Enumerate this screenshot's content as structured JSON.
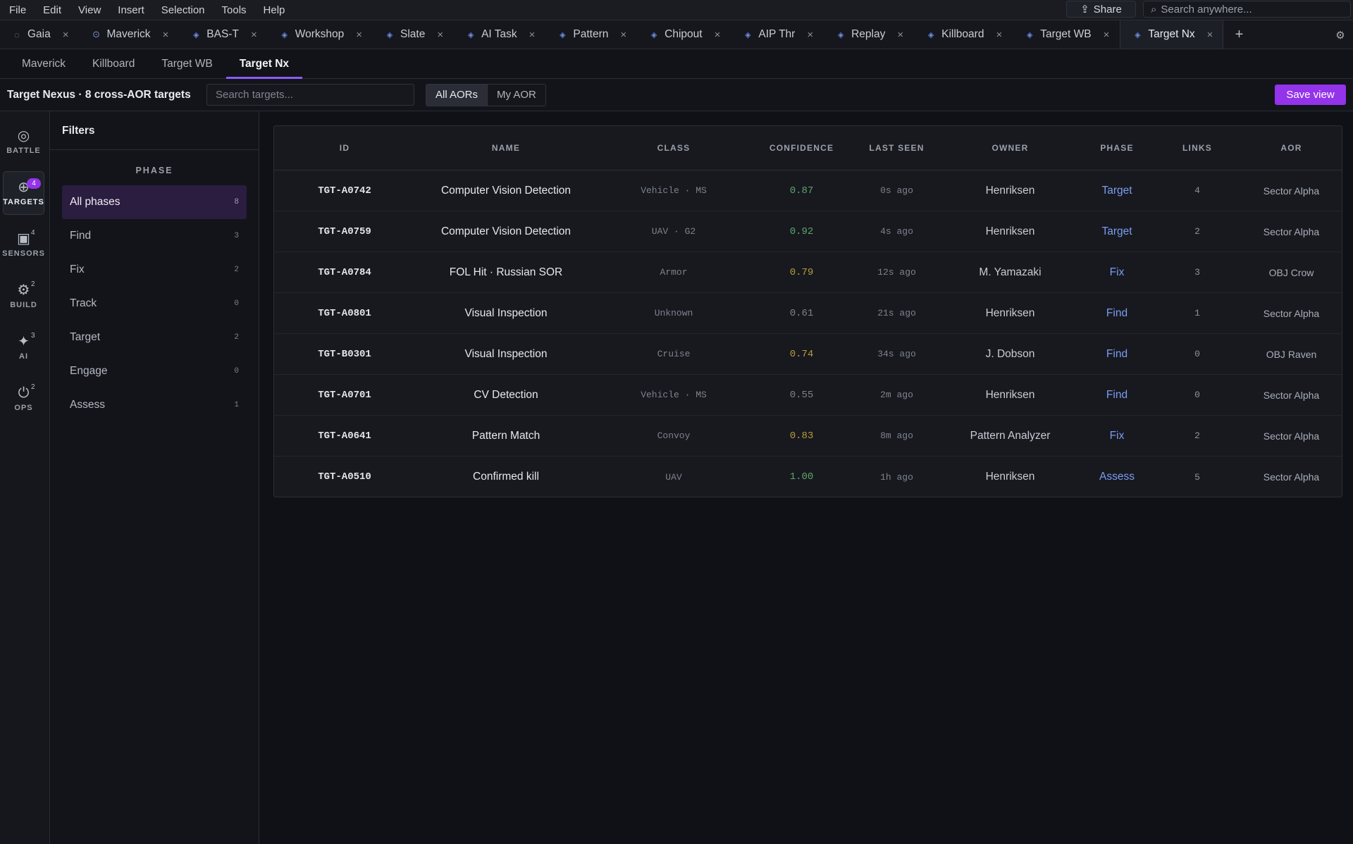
{
  "menu": [
    "File",
    "Edit",
    "View",
    "Insert",
    "Selection",
    "Tools",
    "Help"
  ],
  "share": {
    "label": "Share",
    "icon": "share-icon"
  },
  "global_search": {
    "placeholder": "Search anywhere..."
  },
  "doc_tabs": [
    {
      "label": "Gaia",
      "icon": "circle-icon"
    },
    {
      "label": "Maverick",
      "icon": "target-icon"
    },
    {
      "label": "BAS-T",
      "icon": "diamond-icon"
    },
    {
      "label": "Workshop",
      "icon": "diamond-icon"
    },
    {
      "label": "Slate",
      "icon": "diamond-icon"
    },
    {
      "label": "AI Task",
      "icon": "diamond-icon"
    },
    {
      "label": "Pattern",
      "icon": "diamond-icon"
    },
    {
      "label": "Chipout",
      "icon": "diamond-icon"
    },
    {
      "label": "AIP Thr",
      "icon": "diamond-icon"
    },
    {
      "label": "Replay",
      "icon": "diamond-icon"
    },
    {
      "label": "Killboard",
      "icon": "diamond-icon"
    },
    {
      "label": "Target WB",
      "icon": "diamond-icon"
    },
    {
      "label": "Target Nx",
      "icon": "diamond-icon",
      "active": true
    }
  ],
  "sub_tabs": [
    {
      "label": "Maverick"
    },
    {
      "label": "Killboard"
    },
    {
      "label": "Target WB"
    },
    {
      "label": "Target Nx",
      "active": true
    }
  ],
  "toolbar": {
    "title": "Target Nexus · 8 cross-AOR targets",
    "search_placeholder": "Search targets...",
    "aor_all": "All AORs",
    "aor_mine": "My AOR",
    "save_label": "Save view"
  },
  "rail": [
    {
      "label": "BATTLE",
      "icon": "battle-icon",
      "badge": ""
    },
    {
      "label": "TARGETS",
      "icon": "crosshair-icon",
      "badge": "4",
      "active": true
    },
    {
      "label": "SENSORS",
      "icon": "sensor-icon",
      "badge": "4"
    },
    {
      "label": "BUILD",
      "icon": "gear-icon",
      "badge": "2"
    },
    {
      "label": "AI",
      "icon": "sparkle-icon",
      "badge": "3"
    },
    {
      "label": "OPS",
      "icon": "power-icon",
      "badge": "2"
    }
  ],
  "filters": {
    "title": "Filters",
    "phase_heading": "PHASE",
    "phases": [
      {
        "label": "All phases",
        "count": "8",
        "active": true
      },
      {
        "label": "Find",
        "count": "3"
      },
      {
        "label": "Fix",
        "count": "2"
      },
      {
        "label": "Track",
        "count": "0"
      },
      {
        "label": "Target",
        "count": "2"
      },
      {
        "label": "Engage",
        "count": "0"
      },
      {
        "label": "Assess",
        "count": "1"
      }
    ]
  },
  "table": {
    "columns": [
      "ID",
      "NAME",
      "CLASS",
      "CONFIDENCE",
      "LAST SEEN",
      "OWNER",
      "PHASE",
      "LINKS",
      "AOR"
    ],
    "rows": [
      {
        "id": "TGT-A0742",
        "name": "Computer Vision Detection",
        "class": "Vehicle · MS",
        "confidence": "0.87",
        "last_seen": "0s ago",
        "owner": "Henriksen",
        "phase": "Target",
        "links": "4",
        "aor": "Sector Alpha"
      },
      {
        "id": "TGT-A0759",
        "name": "Computer Vision Detection",
        "class": "UAV · G2",
        "confidence": "0.92",
        "last_seen": "4s ago",
        "owner": "Henriksen",
        "phase": "Target",
        "links": "2",
        "aor": "Sector Alpha"
      },
      {
        "id": "TGT-A0784",
        "name": "FOL Hit · Russian SOR",
        "class": "Armor",
        "confidence": "0.79",
        "last_seen": "12s ago",
        "owner": "M. Yamazaki",
        "phase": "Fix",
        "links": "3",
        "aor": "OBJ Crow"
      },
      {
        "id": "TGT-A0801",
        "name": "Visual Inspection",
        "class": "Unknown",
        "confidence": "0.61",
        "last_seen": "21s ago",
        "owner": "Henriksen",
        "phase": "Find",
        "links": "1",
        "aor": "Sector Alpha"
      },
      {
        "id": "TGT-B0301",
        "name": "Visual Inspection",
        "class": "Cruise",
        "confidence": "0.74",
        "last_seen": "34s ago",
        "owner": "J. Dobson",
        "phase": "Find",
        "links": "0",
        "aor": "OBJ Raven"
      },
      {
        "id": "TGT-A0701",
        "name": "CV Detection",
        "class": "Vehicle · MS",
        "confidence": "0.55",
        "last_seen": "2m ago",
        "owner": "Henriksen",
        "phase": "Find",
        "links": "0",
        "aor": "Sector Alpha"
      },
      {
        "id": "TGT-A0641",
        "name": "Pattern Match",
        "class": "Convoy",
        "confidence": "0.83",
        "last_seen": "8m ago",
        "owner": "Pattern Analyzer",
        "phase": "Fix",
        "links": "2",
        "aor": "Sector Alpha"
      },
      {
        "id": "TGT-A0510",
        "name": "Confirmed kill",
        "class": "UAV",
        "confidence": "1.00",
        "last_seen": "1h ago",
        "owner": "Henriksen",
        "phase": "Assess",
        "links": "5",
        "aor": "Sector Alpha"
      }
    ]
  },
  "colors": {
    "accent": "#9333ea",
    "phase_link": "#7b9cf0",
    "confidence_high": "#5fa46b",
    "confidence_mid": "#b89a3c",
    "confidence_low": "#7d828d"
  }
}
